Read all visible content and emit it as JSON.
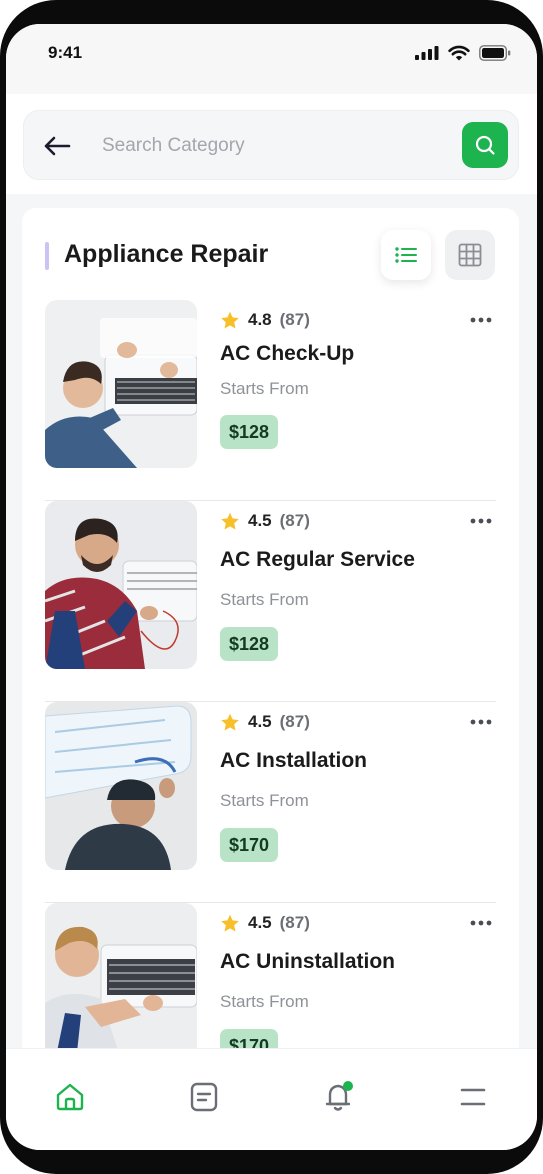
{
  "status_bar": {
    "time": "9:41",
    "icons": [
      "signal-icon",
      "wifi-icon",
      "battery-icon"
    ]
  },
  "search": {
    "placeholder": "Search Category",
    "value": ""
  },
  "section": {
    "title": "Appliance Repair",
    "view_modes": [
      "list",
      "grid"
    ],
    "active_view": "list"
  },
  "services": [
    {
      "rating": "4.8",
      "reviews": "(87)",
      "name": "AC Check-Up",
      "starts_from": "Starts From",
      "price": "$128"
    },
    {
      "rating": "4.5",
      "reviews": "(87)",
      "name": "AC Regular Service",
      "starts_from": "Starts From",
      "price": "$128"
    },
    {
      "rating": "4.5",
      "reviews": "(87)",
      "name": "AC Installation",
      "starts_from": "Starts From",
      "price": "$170"
    },
    {
      "rating": "4.5",
      "reviews": "(87)",
      "name": "AC Uninstallation",
      "starts_from": "Starts From",
      "price": "$170"
    }
  ],
  "bottom_nav": {
    "items": [
      "home-icon",
      "document-icon",
      "bell-icon",
      "menu-icon"
    ],
    "active": "home-icon",
    "notification_dot": true
  },
  "colors": {
    "accent": "#1db34f",
    "price_bg": "#b8e3c6",
    "star": "#f7c02a",
    "section_accent": "#c9c4f3"
  }
}
